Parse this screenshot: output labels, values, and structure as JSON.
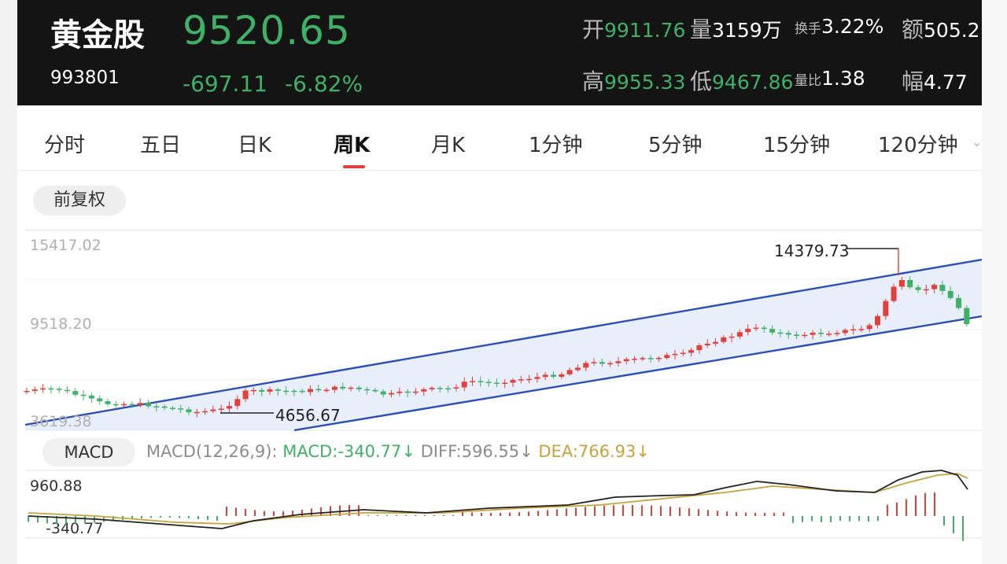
{
  "header": {
    "name": "黄金股",
    "code": "993801",
    "price": "9520.65",
    "change": "-697.11",
    "change_pct": "-6.82%",
    "open_label": "开",
    "open": "9911.76",
    "volume_label": "量",
    "volume": "3159万",
    "turnover_label": "换手",
    "turnover": "3.22%",
    "amount_label": "额",
    "amount": "505.2",
    "high_label": "高",
    "high": "9955.33",
    "low_label": "低",
    "low": "9467.86",
    "vol_ratio_label": "量比",
    "vol_ratio": "1.38",
    "amplitude_label": "幅",
    "amplitude": "4.77"
  },
  "tabs": [
    "分时",
    "五日",
    "日K",
    "周K",
    "月K",
    "1分钟",
    "5分钟",
    "15分钟",
    "120分钟"
  ],
  "active_tab": "周K",
  "adjust_button": "前复权",
  "price_axis": {
    "top": "15417.02",
    "mid": "9518.20",
    "bottom": "3619.38"
  },
  "annotations": {
    "low": "4656.67",
    "high": "14379.73"
  },
  "macd": {
    "button": "MACD",
    "params": "MACD(12,26,9):",
    "macd_value": "MACD:-340.77↓",
    "diff_value": "DIFF:596.55↓",
    "dea_value": "DEA:766.93↓",
    "axis_top": "960.88",
    "axis_bottom": "-340.77"
  },
  "colors": {
    "up": "#e0413a",
    "down": "#3fb166",
    "channel": "#2a4fb5",
    "diff": "#222222",
    "dea": "#c8a23c",
    "header_bg": "#141414"
  }
}
